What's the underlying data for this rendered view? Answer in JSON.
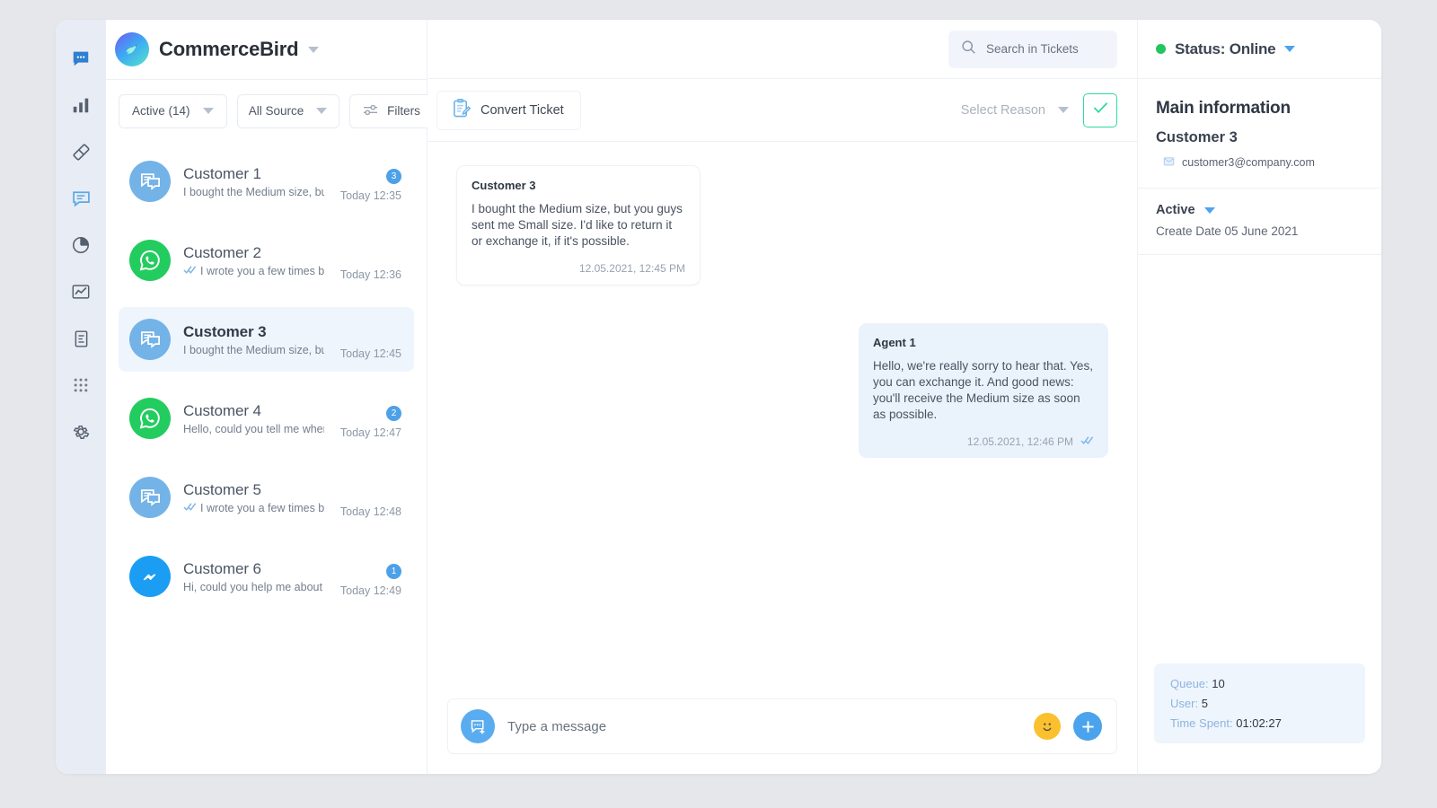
{
  "brand": {
    "name": "CommerceBird",
    "logo_icon": "bird-logo-icon"
  },
  "rail": {
    "items": [
      {
        "name": "chats-active",
        "icon": "chat-bubble-filled-icon"
      },
      {
        "name": "statistics",
        "icon": "bar-chart-icon"
      },
      {
        "name": "tickets",
        "icon": "ticket-tag-icon"
      },
      {
        "name": "messages",
        "icon": "chat-bubble-outline-icon"
      },
      {
        "name": "reports",
        "icon": "pie-chart-icon"
      },
      {
        "name": "analytics",
        "icon": "line-chart-icon"
      },
      {
        "name": "documents",
        "icon": "document-icon"
      },
      {
        "name": "apps",
        "icon": "grid-apps-icon"
      },
      {
        "name": "settings",
        "icon": "gear-icon"
      }
    ]
  },
  "filters": {
    "status": "Active (14)",
    "source": "All Source",
    "filters_label": "Filters"
  },
  "search": {
    "placeholder": "Search in Tickets",
    "value": ""
  },
  "conversations": [
    {
      "name": "Customer 1",
      "snippet": "I bought the Medium size, but you guys...",
      "time": "Today 12:35",
      "badge": "3",
      "channel": "chat",
      "read_receipt": false,
      "selected": false
    },
    {
      "name": "Customer 2",
      "snippet": "I wrote you a few times before for...",
      "time": "Today 12:36",
      "badge": "",
      "channel": "whatsapp",
      "read_receipt": true,
      "selected": false
    },
    {
      "name": "Customer 3",
      "snippet": "I bought the Medium size, but you...",
      "time": "Today 12:45",
      "badge": "",
      "channel": "chat",
      "read_receipt": false,
      "selected": true
    },
    {
      "name": "Customer 4",
      "snippet": "Hello, could you tell me where my...",
      "time": "Today 12:47",
      "badge": "2",
      "channel": "whatsapp",
      "read_receipt": false,
      "selected": false
    },
    {
      "name": "Customer 5",
      "snippet": "I wrote you a few times before for...",
      "time": "Today 12:48",
      "badge": "",
      "channel": "chat",
      "read_receipt": true,
      "selected": false
    },
    {
      "name": "Customer 6",
      "snippet": "Hi, could you help me about something?",
      "time": "Today 12:49",
      "badge": "1",
      "channel": "messenger",
      "read_receipt": false,
      "selected": false
    }
  ],
  "toolbar": {
    "convert_ticket": "Convert Ticket",
    "select_reason": "Select Reason",
    "confirm_icon": "check-icon"
  },
  "messages": [
    {
      "author": "Customer 3",
      "text": "I bought the Medium size, but you guys sent me Small size. I'd like to return it or exchange it, if it's possible.",
      "timestamp": "12.05.2021, 12:45 PM",
      "direction": "inbound",
      "read_receipt": false
    },
    {
      "author": "Agent 1",
      "text": "Hello, we're really sorry to hear that. Yes, you can exchange it. And good news: you'll receive the Medium size as soon as possible.",
      "timestamp": "12.05.2021, 12:46 PM",
      "direction": "outbound",
      "read_receipt": true
    }
  ],
  "composer": {
    "placeholder": "Type a message",
    "value": "",
    "emoji_icon": "smiley-face-icon",
    "attach_icon": "plus-icon",
    "avatar_icon": "new-message-icon"
  },
  "right_panel": {
    "status": "Status: Online",
    "status_color": "#23c55e",
    "main_information_title": "Main information",
    "customer_name": "Customer 3",
    "email": "customer3@company.com",
    "state": "Active",
    "create_date": "Create Date 05 June 2021",
    "stats": {
      "queue_label": "Queue:",
      "queue_value": "10",
      "user_label": "User:",
      "user_value": "5",
      "time_spent_label": "Time Spent:",
      "time_spent_value": "01:02:27"
    }
  },
  "colors": {
    "accent_blue": "#4ca1e8",
    "whatsapp_green": "#23cc5f",
    "messenger_blue": "#1b9df4",
    "confirm_green": "#2ddb9a",
    "selected_row": "#eff5fd"
  }
}
